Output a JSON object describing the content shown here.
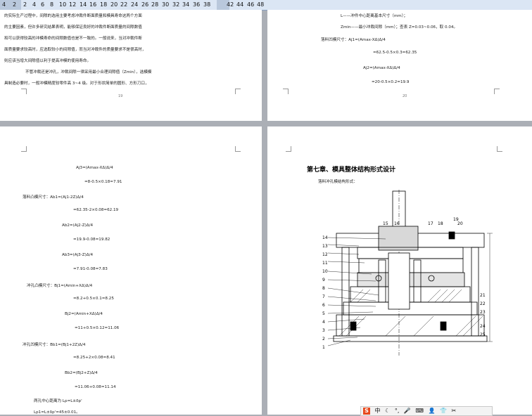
{
  "ruler": {
    "labels": [
      "4",
      "2",
      "2",
      "4",
      "6",
      "8",
      "10",
      "12",
      "14",
      "16",
      "18",
      "20",
      "22",
      "24",
      "26",
      "28",
      "30",
      "32",
      "34",
      "36",
      "38",
      "42",
      "44",
      "46",
      "48"
    ]
  },
  "page1": {
    "lines": [
      "的实际生产过程中，间隙的选用主要考虑冲裁件断面质量和模具寿命这两个方面",
      "的主要因素，但许多研究结果表明，能够保证良好的冲裁件断面质量的间隙数值",
      "和可以获得较高的冲模寿命的间隙数值也是不一致的。一般说来，当对冲裁件断",
      "面质量要求较高时，应选取较小的间隙值，而当对冲裁件的质量要求不是很高时，",
      "则应该当增大间隙值以利于提高冲模的使用寿命。",
      "不管冲裁还是冲孔，冲裁间隙一律采用最小合理间隙值（Zmin），选模模",
      "具制造必要时，一般冲模精度较零件高 3~4 级。对于形状简单的圆形、方形刀口，"
    ],
    "page_number": "19"
  },
  "page2": {
    "lines": [
      "L——冲件中心距离基本尺寸（mm）；",
      "Zmin——最小冲裁间隙（mm）；查表 Z=0.03~0.06，取 0.04。",
      "落料凹模尺寸：Aj1=(Amax-XΔ)Δ/4",
      "=62.5-0.5×0.3=62.35",
      "Aj2=(Amax-XΔ)Δ/4",
      "=20-0.5×0.2=19.9"
    ],
    "page_number": "20"
  },
  "page3": {
    "lines": [
      "Aj3=(Amax-XΔ)Δ/4",
      "=8-0.5×0.18=7.91",
      "落料凸模尺寸：Ab1=(Aj1-2Z)Δ/4",
      "=62.35-2×0.08=62.19",
      "Ab2=(Aj2-Z)Δ/4",
      "=19.9-0.08=19.82",
      "Ab3=(Aj3-Z)Δ/4",
      "=7.91-0.08=7.83",
      "冲孔凸模尺寸：Bj1=(Amin+XΔ)Δ/4",
      "=8.2+0.5×0.1=8.25",
      "Bj2=(Amin+XΔ)Δ/4",
      "=11+0.5×0.12=11.06",
      "冲孔凹模尺寸：Bb1=(Bj1+2Z)Δ/4",
      "=8.25+2×0.08=8.41",
      "Bb2=(Bj2+Z)Δ/4",
      "=11.06+0.08=11.14",
      "两孔中心距离为 Lp=L±δp'",
      "Lp1=L±δp'=45±0.01。"
    ]
  },
  "page4": {
    "heading": "第七章、模具整体结构形式设计",
    "subheading": "落料冲孔模结构形式：",
    "part_numbers_left": [
      "14",
      "13",
      "12",
      "11",
      "10",
      "9",
      "8",
      "7",
      "6",
      "5",
      "4",
      "3",
      "2",
      "1"
    ],
    "part_numbers_top": [
      "15",
      "16",
      "17",
      "18",
      "19",
      "20"
    ],
    "part_numbers_right": [
      "21",
      "22",
      "23",
      "24",
      "25"
    ]
  },
  "ime_toolbar": {
    "logo": "S",
    "lang": "中"
  }
}
